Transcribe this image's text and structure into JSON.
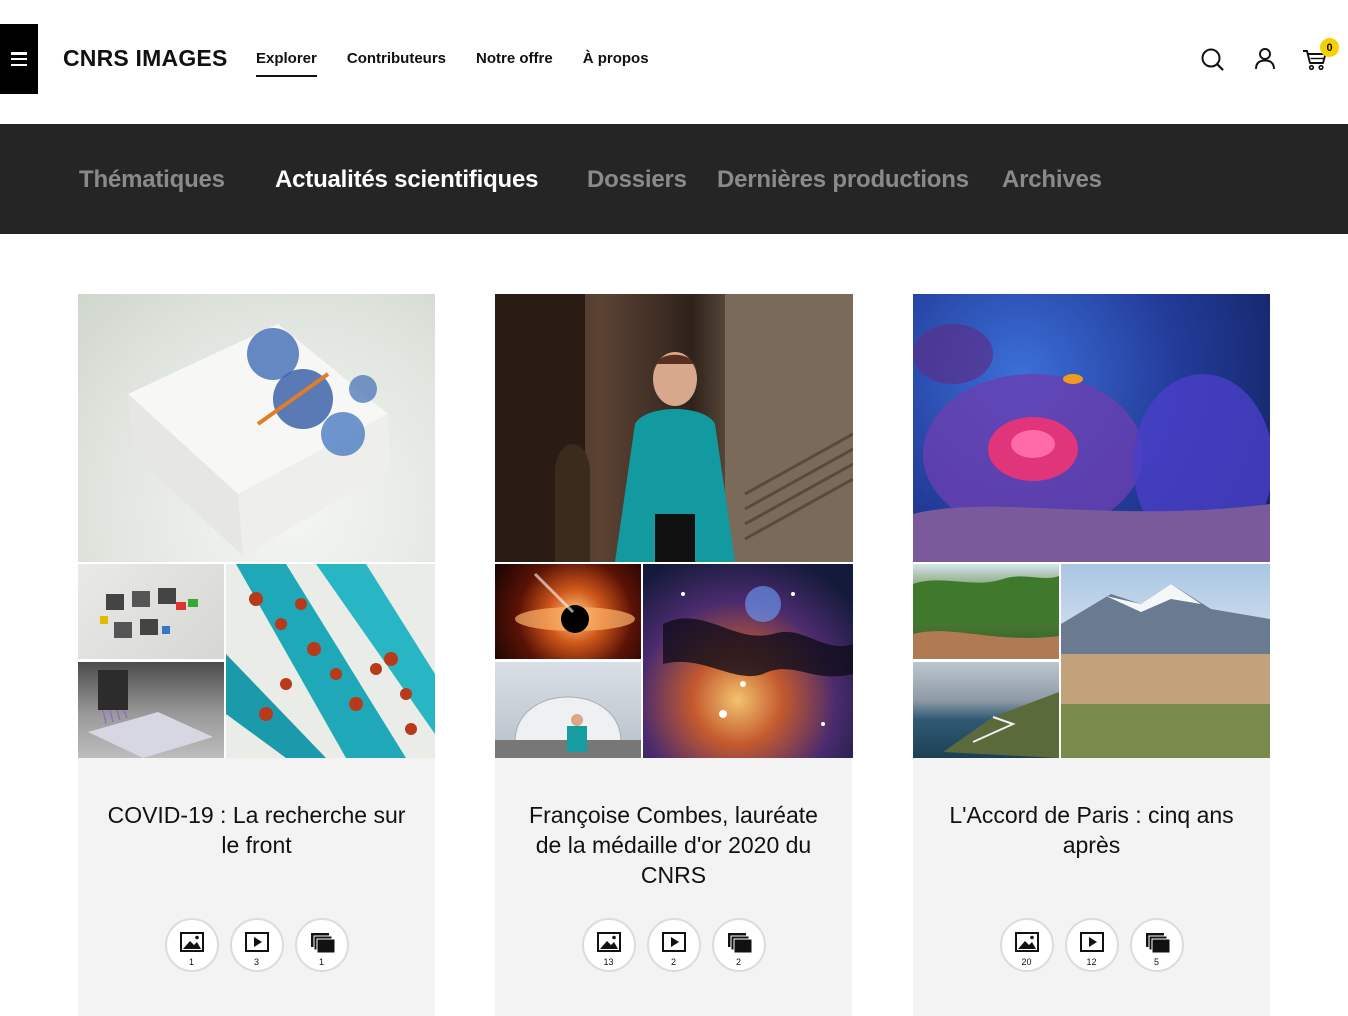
{
  "header": {
    "logo": "CNRS IMAGES",
    "nav": [
      "Explorer",
      "Contributeurs",
      "Notre offre",
      "À propos"
    ],
    "active_nav": "Explorer",
    "cart_count": "0",
    "icons": {
      "menu": "hamburger-menu-icon",
      "search": "search-icon",
      "account": "user-icon",
      "cart": "cart-icon"
    }
  },
  "subnav": {
    "items": [
      "Thématiques",
      "Actualités scientifiques",
      "Dossiers",
      "Dernières productions",
      "Archives"
    ],
    "active": "Actualités scientifiques"
  },
  "colors": {
    "subnav_bg": "#252525",
    "subnav_active": "#ffffff",
    "subnav_inactive": "#8a8a8a",
    "card_bg": "#f3f3f3",
    "cart_badge": "#f7d000"
  },
  "cards": [
    {
      "title": "COVID-19 : La recherche sur le front",
      "counts": {
        "images": "1",
        "videos": "3",
        "series": "1"
      }
    },
    {
      "title": "Françoise Combes, lauréate de la médaille d'or 2020 du CNRS",
      "counts": {
        "images": "13",
        "videos": "2",
        "series": "2"
      }
    },
    {
      "title": "L'Accord de Paris : cinq ans après",
      "counts": {
        "images": "20",
        "videos": "12",
        "series": "5"
      }
    }
  ]
}
